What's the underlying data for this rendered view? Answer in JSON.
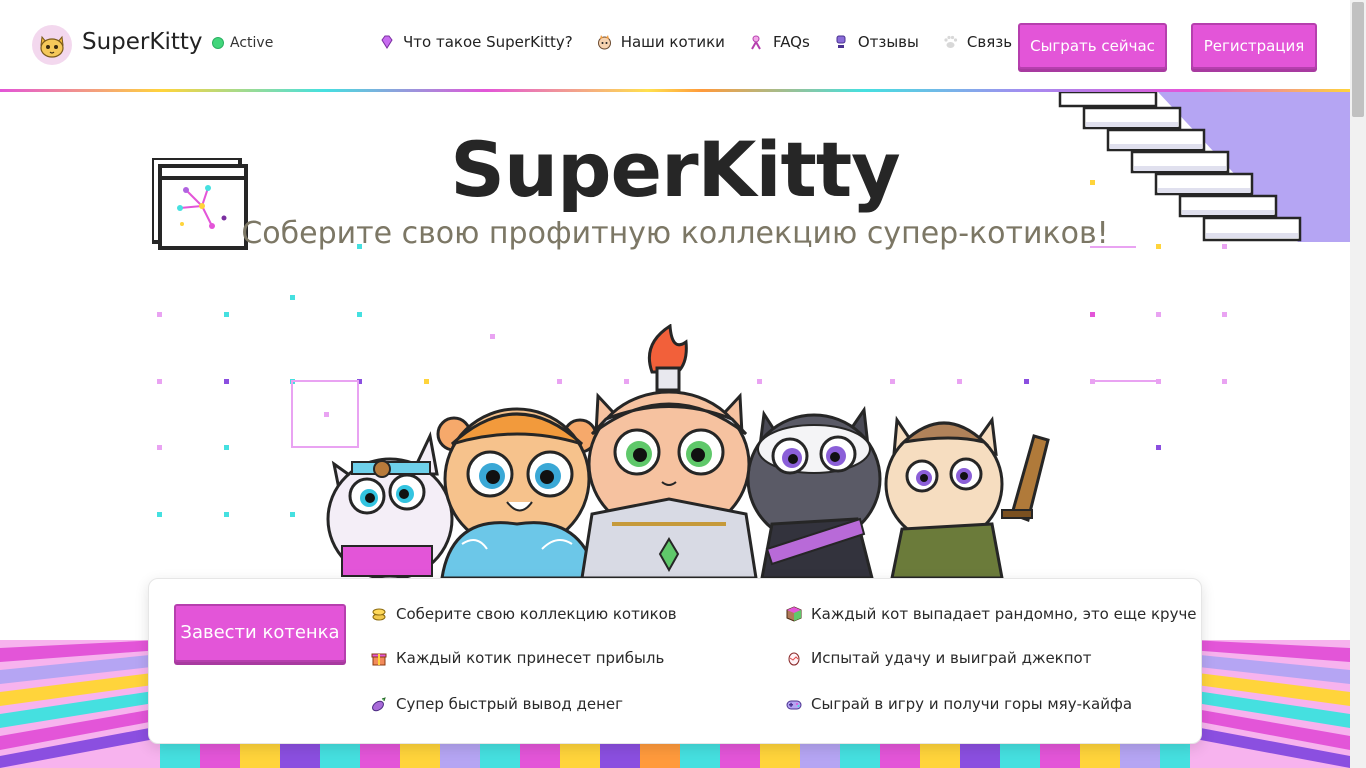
{
  "header": {
    "brand": "SuperKitty",
    "status": "Active",
    "nav": [
      {
        "label": "Что такое SuperKitty?",
        "icon": "diamond-icon"
      },
      {
        "label": "Наши котики",
        "icon": "cat-icon"
      },
      {
        "label": "FAQs",
        "icon": "ribbon-icon"
      },
      {
        "label": "Отзывы",
        "icon": "trophy-icon"
      },
      {
        "label": "Связь",
        "icon": "paw-icon"
      }
    ],
    "play_label": "Сыграть сейчас",
    "register_label": "Регистрация"
  },
  "hero": {
    "title": "SuperKitty",
    "subtitle": "Соберите свою профитную коллекцию супер-котиков!"
  },
  "features": {
    "cta_label": "Завести котенка",
    "items": [
      {
        "label": "Соберите свою коллекцию котиков",
        "icon": "coins-icon"
      },
      {
        "label": "Каждый котик принесет прибыль",
        "icon": "gift-icon"
      },
      {
        "label": "Супер быстрый вывод денег",
        "icon": "eggplant-icon"
      },
      {
        "label": "Каждый кот выпадает рандомно, это еще круче",
        "icon": "cube-icon"
      },
      {
        "label": "Испытай удачу и выиграй джекпот",
        "icon": "egg-icon"
      },
      {
        "label": "Сыграй в игру и получи горы мяу-кайфа",
        "icon": "gamepad-icon"
      }
    ]
  },
  "colors": {
    "accent": "#e355d8",
    "accent_dark": "#b63fae",
    "status_green": "#42d67b",
    "purple": "#b5a5f3",
    "cyan": "#45e0e0",
    "yellow": "#ffd43b"
  }
}
